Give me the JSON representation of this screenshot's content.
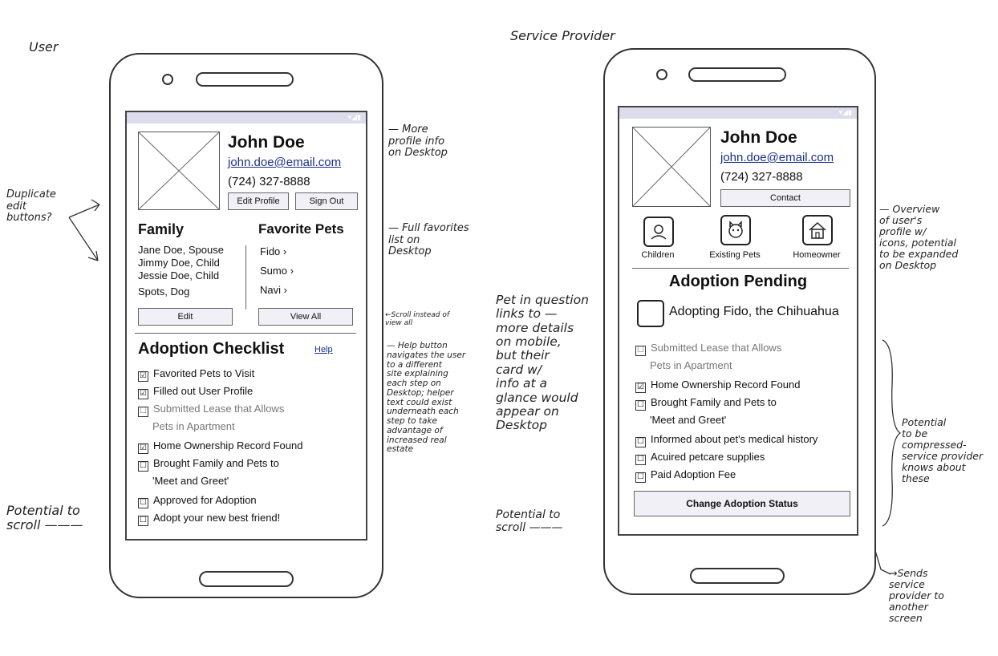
{
  "labels": {
    "user": "User",
    "provider": "Service Provider"
  },
  "notes": {
    "duplicate": "Duplicate\nedit\nbuttons?",
    "more_profile": "— More\nprofile info\non Desktop",
    "full_favorites": "— Full favorites\nlist on\nDesktop",
    "scroll_instead": "←Scroll instead of\nview all",
    "help_button": "— Help button\nnavigates the user\nto a different\nsite explaining\neach step on\nDesktop; helper\ntext could exist\nunderneath each\nstep to take\nadvantage of\nincreased real\nestate",
    "pet_question": "Pet in question\nlinks to —\nmore details\non mobile,\nbut their\ncard w/\ninfo at a\nglance would\nappear on\nDesktop",
    "potential_scroll_left": "Potential to\nscroll ———",
    "potential_scroll_mid": "Potential to\nscroll ———",
    "overview": "— Overview\nof user's\nprofile w/\nicons, potential\nto be expanded\non Desktop",
    "compressed": "Potential\nto be\ncompressed-\nservice provider\nknows about\nthese",
    "sends": "→Sends\nservice\nprovider to\nanother\nscreen"
  },
  "user_screen": {
    "name": "John Doe",
    "email": "john.doe@email.com",
    "phone": "(724) 327-8888",
    "edit_profile": "Edit Profile",
    "sign_out": "Sign Out",
    "family_title": "Family",
    "family": [
      "Jane Doe, Spouse",
      "Jimmy Doe, Child",
      "Jessie Doe, Child",
      "Spots, Dog"
    ],
    "favorites_title": "Favorite Pets",
    "favorites": [
      "Fido ›",
      "Sumo ›",
      "Navi ›"
    ],
    "edit": "Edit",
    "view_all": "View All",
    "checklist_title": "Adoption Checklist",
    "help": "Help",
    "checklist": [
      {
        "text": "Favorited Pets to Visit",
        "mark": "☑"
      },
      {
        "text": "Filled out User Profile",
        "mark": "☑"
      },
      {
        "text": "Submitted Lease that Allows",
        "mark": "☐"
      },
      {
        "text": "Pets in Apartment",
        "mark": ""
      },
      {
        "text": "Home Ownership Record Found",
        "mark": "☑"
      },
      {
        "text": "Brought Family and Pets to",
        "mark": "☐"
      },
      {
        "text": "'Meet and Greet'",
        "mark": ""
      },
      {
        "text": "Approved for Adoption",
        "mark": "☐"
      },
      {
        "text": "Adopt your new best friend!",
        "mark": "☐"
      }
    ]
  },
  "provider_screen": {
    "name": "John Doe",
    "email": "john.doe@email.com",
    "phone": "(724) 327-8888",
    "contact": "Contact",
    "icons": [
      {
        "label": "Children",
        "icon": "person-icon"
      },
      {
        "label": "Existing Pets",
        "icon": "cat-icon"
      },
      {
        "label": "Homeowner",
        "icon": "house-icon"
      }
    ],
    "pending_title": "Adoption Pending",
    "adopting": "Adopting Fido, the Chihuahua",
    "checklist": [
      {
        "text": "Submitted Lease that Allows",
        "mark": "☐"
      },
      {
        "text": "Pets in Apartment",
        "mark": ""
      },
      {
        "text": "Home Ownership Record Found",
        "mark": "☑"
      },
      {
        "text": "Brought Family and Pets to",
        "mark": "☐"
      },
      {
        "text": "'Meet and Greet'",
        "mark": ""
      },
      {
        "text": "Informed about pet's medical history",
        "mark": "☐"
      },
      {
        "text": "Acuired petcare supplies",
        "mark": "☐"
      },
      {
        "text": "Paid Adoption Fee",
        "mark": "☐"
      }
    ],
    "change_status": "Change Adoption Status"
  }
}
